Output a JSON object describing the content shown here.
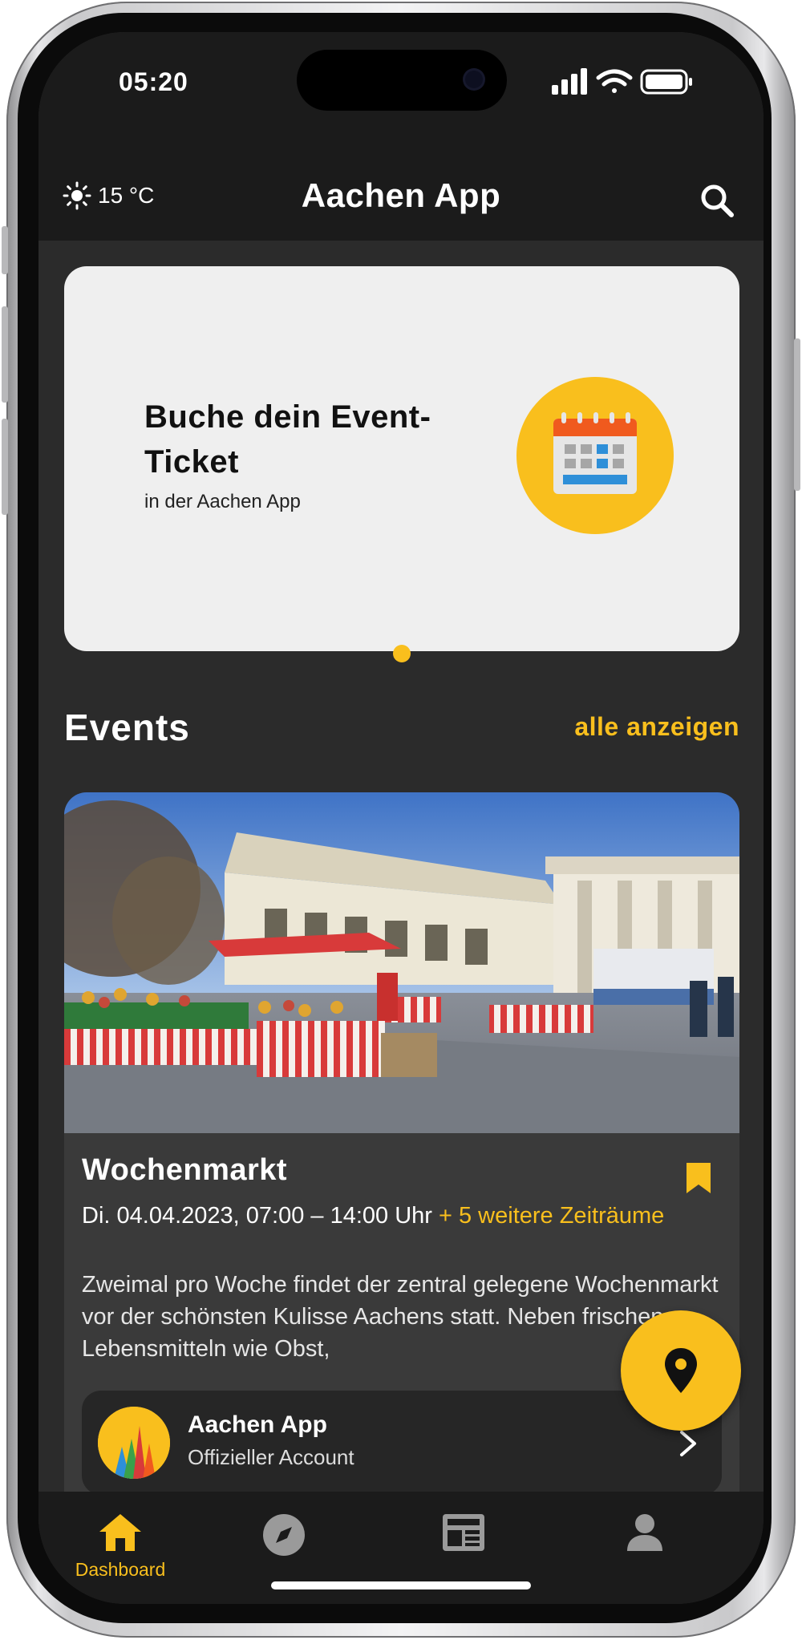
{
  "colors": {
    "accent": "#f9bf1d",
    "background": "#2b2b2b",
    "header": "#1b1b1b",
    "card": "#3a3a3a",
    "promo_card": "#efefef",
    "inactive_icon": "#9a9a9a"
  },
  "status_bar": {
    "time": "05:20",
    "icons": [
      "signal-icon",
      "wifi-icon",
      "battery-icon"
    ]
  },
  "header": {
    "weather": {
      "icon": "sun-icon",
      "temperature": "15 °C"
    },
    "title": "Aachen App",
    "search_icon": "search-icon"
  },
  "promo": {
    "title": "Buche dein Event-Ticket",
    "subtitle": "in der Aachen App",
    "icon": "calendar-icon"
  },
  "events": {
    "section_title": "Events",
    "show_all_label": "alle anzeigen",
    "items": [
      {
        "title": "Wochenmarkt",
        "date": "Di. 04.04.2023, 07:00 – 14:00 Uhr",
        "more_periods": "+ 5 weitere Zeiträume",
        "description": "Zweimal pro Woche findet der zentral gelegene Wochenmarkt vor der schönsten Kulisse Aachens statt. Neben frischen Lebensmitteln wie Obst,",
        "bookmarked": true,
        "organizer": {
          "name": "Aachen App",
          "subtitle": "Offizieller Account"
        }
      }
    ]
  },
  "fab": {
    "icon": "location-pin-icon"
  },
  "tab_bar": {
    "tabs": [
      {
        "label": "Dashboard",
        "icon": "home-icon",
        "active": true
      },
      {
        "label": "",
        "icon": "compass-icon",
        "active": false
      },
      {
        "label": "",
        "icon": "news-icon",
        "active": false
      },
      {
        "label": "",
        "icon": "profile-icon",
        "active": false
      }
    ]
  }
}
